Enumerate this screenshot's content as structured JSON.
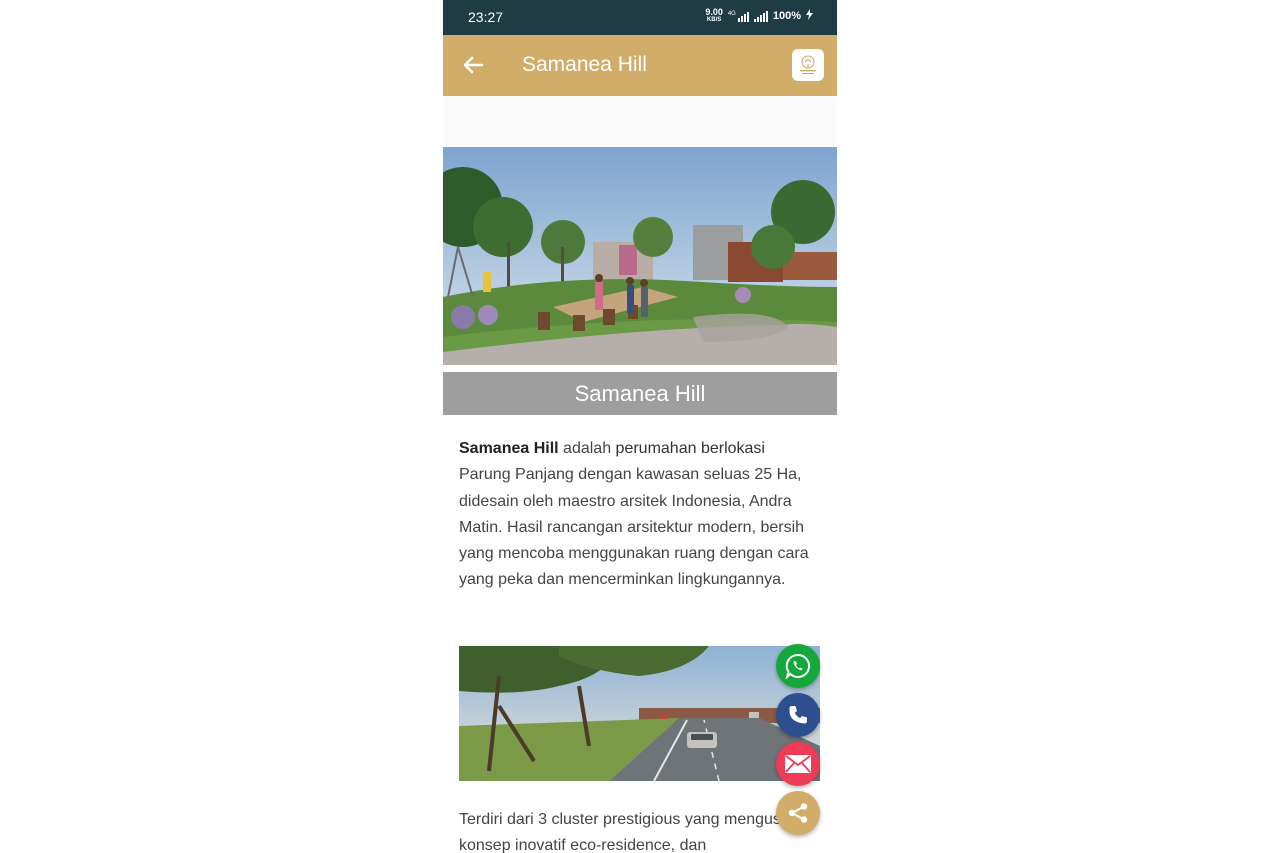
{
  "status_bar": {
    "time": "23:27",
    "net_speed": "9.00",
    "net_unit": "KB/S",
    "net_type": "4G",
    "battery": "100%"
  },
  "app_bar": {
    "title": "Samanea Hill",
    "back_icon": "arrow-left-icon",
    "logo_icon": "samanea-hill-logo"
  },
  "hero": {
    "caption": "Samanea Hill"
  },
  "description": {
    "bold_name": "Samanea Hill",
    "part1": " adalah ",
    "part2": "perumahan berlokasi",
    "part3": " Parung Panjang dengan kawasan seluas 25 Ha, didesain oleh maestro arsitek Indonesia, Andra Matin. Hasil rancangan arsitektur modern, bersih yang mencoba menggunakan ruang dengan cara yang peka dan mencerminkan lingkungannya."
  },
  "description2": {
    "text": "Terdiri dari 3 cluster prestigious yang mengusung konsep inovatif eco-residence, dan"
  },
  "fabs": [
    {
      "icon": "whatsapp-icon",
      "color": "#14a83a"
    },
    {
      "icon": "phone-icon",
      "color": "#2e4f8f"
    },
    {
      "icon": "mail-icon",
      "color": "#ee3c56"
    },
    {
      "icon": "share-icon",
      "color": "#d2ad6a"
    }
  ],
  "colors": {
    "status_bar": "#1f3b43",
    "app_bar": "#d2ad6a",
    "caption_bar": "#9e9e9e"
  }
}
